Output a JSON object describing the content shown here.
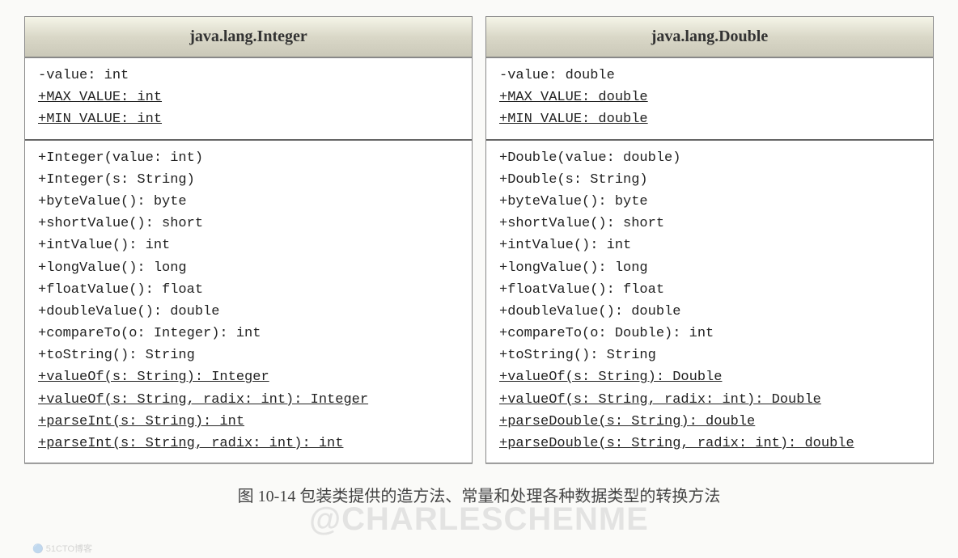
{
  "tables": [
    {
      "title": "java.lang.Integer",
      "fields": [
        {
          "text": "-value: int",
          "underline": false
        },
        {
          "text": "+MAX_VALUE: int",
          "underline": true
        },
        {
          "text": "+MIN_VALUE: int",
          "underline": true
        }
      ],
      "methods": [
        {
          "text": "+Integer(value: int)",
          "underline": false
        },
        {
          "text": "+Integer(s: String)",
          "underline": false
        },
        {
          "text": "+byteValue(): byte",
          "underline": false
        },
        {
          "text": "+shortValue(): short",
          "underline": false
        },
        {
          "text": "+intValue(): int",
          "underline": false
        },
        {
          "text": "+longValue(): long",
          "underline": false
        },
        {
          "text": "+floatValue(): float",
          "underline": false
        },
        {
          "text": "+doubleValue(): double",
          "underline": false
        },
        {
          "text": "+compareTo(o: Integer): int",
          "underline": false
        },
        {
          "text": "+toString(): String",
          "underline": false
        },
        {
          "text": "+valueOf(s: String): Integer",
          "underline": true
        },
        {
          "text": "+valueOf(s: String, radix: int): Integer",
          "underline": true
        },
        {
          "text": "+parseInt(s: String): int",
          "underline": true
        },
        {
          "text": "+parseInt(s: String, radix: int): int",
          "underline": true
        }
      ]
    },
    {
      "title": "java.lang.Double",
      "fields": [
        {
          "text": "-value: double",
          "underline": false
        },
        {
          "text": "+MAX_VALUE: double",
          "underline": true
        },
        {
          "text": "+MIN_VALUE: double",
          "underline": true
        }
      ],
      "methods": [
        {
          "text": "+Double(value: double)",
          "underline": false
        },
        {
          "text": "+Double(s: String)",
          "underline": false
        },
        {
          "text": "+byteValue(): byte",
          "underline": false
        },
        {
          "text": "+shortValue(): short",
          "underline": false
        },
        {
          "text": "+intValue(): int",
          "underline": false
        },
        {
          "text": "+longValue(): long",
          "underline": false
        },
        {
          "text": "+floatValue(): float",
          "underline": false
        },
        {
          "text": "+doubleValue(): double",
          "underline": false
        },
        {
          "text": "+compareTo(o: Double): int",
          "underline": false
        },
        {
          "text": "+toString(): String",
          "underline": false
        },
        {
          "text": "+valueOf(s: String): Double",
          "underline": true
        },
        {
          "text": "+valueOf(s: String, radix: int): Double",
          "underline": true
        },
        {
          "text": "+parseDouble(s: String): double",
          "underline": true
        },
        {
          "text": "+parseDouble(s: String, radix: int): double",
          "underline": true
        }
      ]
    }
  ],
  "caption": "图 10-14  包装类提供的造方法、常量和处理各种数据类型的转换方法",
  "watermark": "@CHARLESCHENME",
  "small_watermark": "🔵 51CTO博客"
}
